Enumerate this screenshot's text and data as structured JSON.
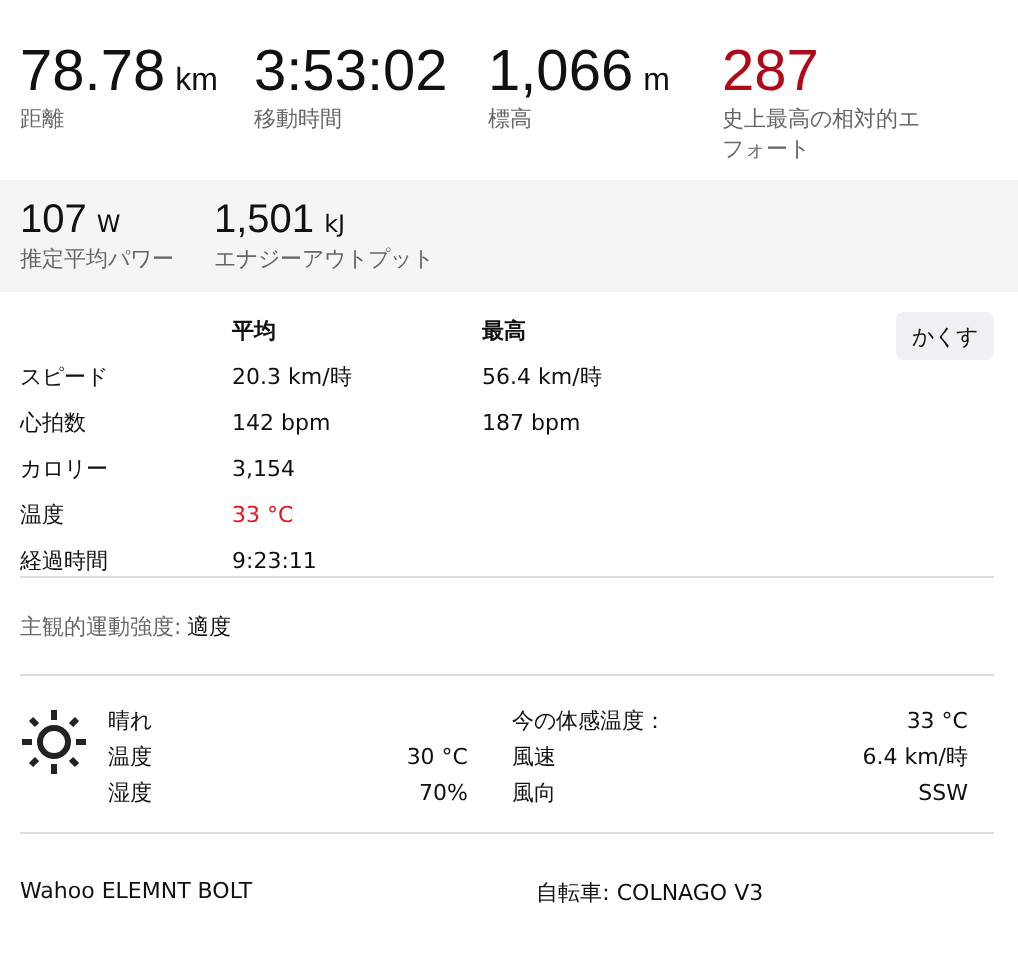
{
  "stats": [
    {
      "value": "78.78",
      "unit": "km",
      "label": "距離",
      "highlighted": false
    },
    {
      "value": "3:53:02",
      "label": "移動時間",
      "highlighted": false
    },
    {
      "value": "1,066",
      "unit": "m",
      "label": "標高",
      "highlighted": false
    },
    {
      "value": "287",
      "label": "史上最高の相対的エフォート",
      "highlighted": true
    }
  ],
  "secondary_stats": [
    {
      "value": "107",
      "unit": "W",
      "label": "推定平均パワー"
    },
    {
      "value": "1,501",
      "unit": "kJ",
      "label": "エナジーアウトプット"
    }
  ],
  "details": {
    "columns": [
      "平均",
      "最高"
    ],
    "hide_button": "かくす",
    "rows": [
      {
        "label": "スピード",
        "avg": "20.3 km/時",
        "max": "56.4 km/時",
        "warning": false
      },
      {
        "label": "心拍数",
        "avg": "142 bpm",
        "max": "187 bpm",
        "warning": false
      },
      {
        "label": "カロリー",
        "avg": "3,154",
        "warning": false
      },
      {
        "label": "温度",
        "avg": "33 °C",
        "warning": true
      },
      {
        "label": "経過時間",
        "avg": "9:23:11",
        "warning": false
      }
    ]
  },
  "perceived_exertion": {
    "label": "主観的運動強度:",
    "value": "適度"
  },
  "weather": {
    "condition": "晴れ",
    "left": [
      {
        "label": "温度",
        "value": "30 °C"
      },
      {
        "label": "湿度",
        "value": "70%"
      }
    ],
    "right": [
      {
        "label": "今の体感温度：",
        "value": "33 °C"
      },
      {
        "label": "風速",
        "value": "6.4 km/時"
      },
      {
        "label": "風向",
        "value": "SSW"
      }
    ]
  },
  "footer": {
    "device": "Wahoo ELEMNT BOLT",
    "bike": "自転車: COLNAGO V3"
  }
}
